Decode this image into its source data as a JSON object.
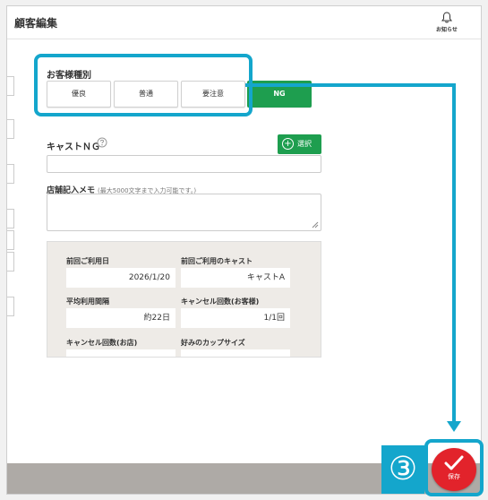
{
  "header": {
    "title": "顧客編集",
    "notification_label": "お知らせ"
  },
  "customer_type": {
    "label": "お客様種別",
    "options": [
      {
        "label": "優良"
      },
      {
        "label": "普通"
      },
      {
        "label": "要注意"
      },
      {
        "label": "NG"
      }
    ],
    "selected": "NG"
  },
  "cast_ng": {
    "label": "キャストＮＧ",
    "select_button": "選択",
    "value": ""
  },
  "store_memo": {
    "label": "店舗記入メモ",
    "hint": "(最大5000文字まで入力可能です。)",
    "value": ""
  },
  "stats": {
    "last_visit_label": "前回ご利用日",
    "last_visit_value": "2026/1/20",
    "last_cast_label": "前回ご利用のキャスト",
    "last_cast_value": "キャストA",
    "avg_interval_label": "平均利用間隔",
    "avg_interval_value": "約22日",
    "cancel_customer_label": "キャンセル回数(お客様)",
    "cancel_customer_value": "1/1回",
    "cancel_store_label": "キャンセル回数(お店)",
    "cup_size_label": "好みのカップサイズ"
  },
  "annotation": {
    "step": "③"
  },
  "save_button": {
    "label": "保存"
  },
  "colors": {
    "accent": "#14a6cc",
    "green": "#1e9e4f",
    "save_red": "#e2232b",
    "footer": "#aeaaa6"
  }
}
